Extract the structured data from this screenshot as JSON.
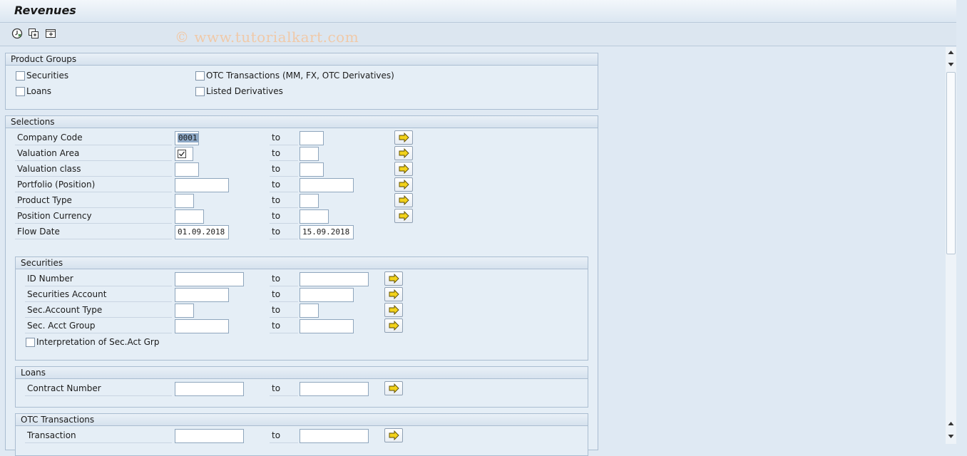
{
  "title": "Revenues",
  "watermark": "© www.tutorialkart.com",
  "toolbar": {
    "icons": [
      "execute-icon",
      "copy-variant-icon",
      "variant-display-icon"
    ]
  },
  "product_groups": {
    "header": "Product Groups",
    "items": [
      "Securities",
      "Loans",
      "OTC Transactions (MM, FX, OTC Derivatives)",
      "Listed Derivatives"
    ]
  },
  "selections": {
    "header": "Selections",
    "to_label": "to",
    "rows": [
      {
        "label": "Company Code",
        "from": "0001",
        "to": ""
      },
      {
        "label": "Valuation Area",
        "from": "",
        "to": ""
      },
      {
        "label": "Valuation class",
        "from": "",
        "to": ""
      },
      {
        "label": "Portfolio (Position)",
        "from": "",
        "to": ""
      },
      {
        "label": "Product Type",
        "from": "",
        "to": ""
      },
      {
        "label": "Position Currency",
        "from": "",
        "to": ""
      },
      {
        "label": "Flow Date",
        "from": "01.09.2018",
        "to": "15.09.2018"
      }
    ]
  },
  "securities": {
    "header": "Securities",
    "rows": [
      {
        "label": "ID Number",
        "from": "",
        "to": ""
      },
      {
        "label": "Securities Account",
        "from": "",
        "to": ""
      },
      {
        "label": "Sec.Account Type",
        "from": "",
        "to": ""
      },
      {
        "label": "Sec. Acct Group",
        "from": "",
        "to": ""
      }
    ],
    "checkbox": "Interpretation of Sec.Act Grp"
  },
  "loans": {
    "header": "Loans",
    "rows": [
      {
        "label": "Contract Number",
        "from": "",
        "to": ""
      }
    ]
  },
  "otc": {
    "header": "OTC Transactions",
    "rows": [
      {
        "label": "Transaction",
        "from": "",
        "to": ""
      }
    ]
  },
  "colors": {
    "background": "#dfe9f3",
    "group_bg": "#e5eef6",
    "arrow_yellow": "#f2d21b"
  }
}
